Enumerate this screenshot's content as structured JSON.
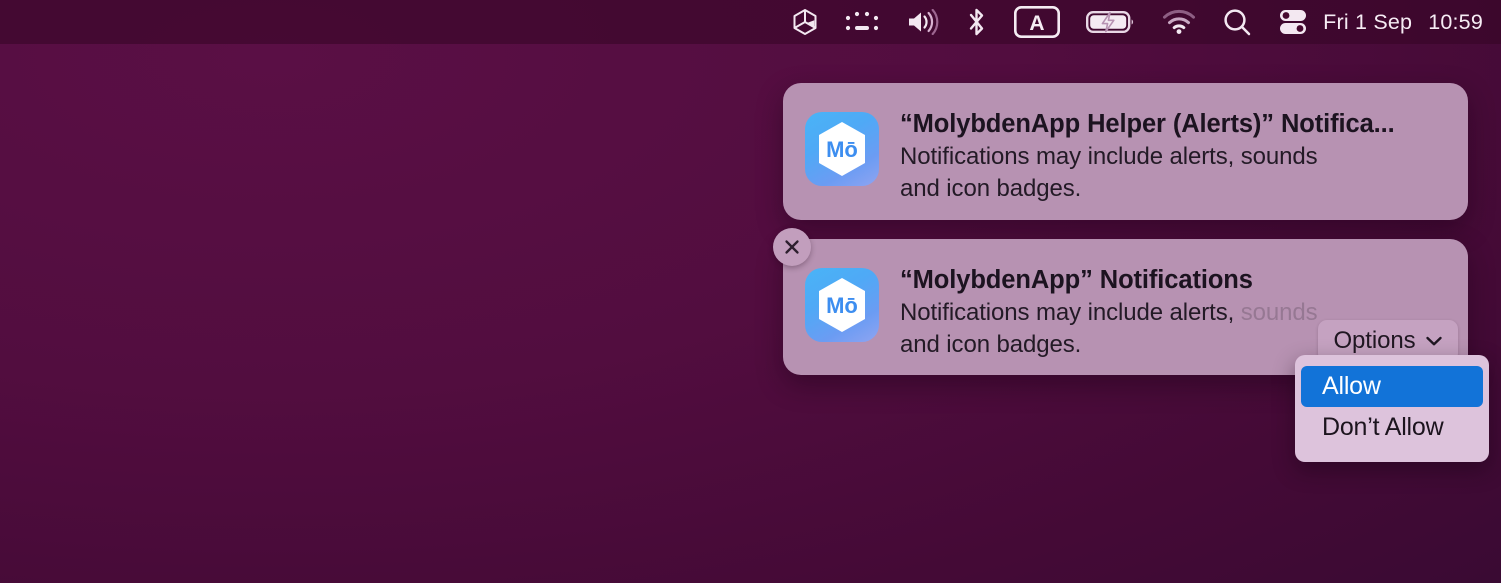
{
  "menubar": {
    "icons": [
      {
        "name": "cube-icon",
        "label": "Cube"
      },
      {
        "name": "keyboard-brightness-icon",
        "label": "Keyboard Brightness"
      },
      {
        "name": "volume-icon",
        "label": "Volume"
      },
      {
        "name": "bluetooth-icon",
        "label": "Bluetooth"
      },
      {
        "name": "input-source-icon",
        "label": "A"
      },
      {
        "name": "battery-charging-icon",
        "label": "Battery Charging"
      },
      {
        "name": "wifi-icon",
        "label": "Wi-Fi"
      },
      {
        "name": "search-icon",
        "label": "Spotlight Search"
      },
      {
        "name": "control-center-icon",
        "label": "Control Center"
      }
    ],
    "input_source_letter": "A",
    "date": "Fri 1 Sep",
    "time": "10:59"
  },
  "dialogs": [
    {
      "id": "helper",
      "app_icon_label": "Mō",
      "title": "“MolybdenApp Helper (Alerts)” Notifica...",
      "body": "Notifications may include alerts, sounds\nand icon badges."
    },
    {
      "id": "main",
      "app_icon_label": "Mō",
      "title": "“MolybdenApp” Notifications",
      "body_visible": "Notifications may include alerts, ",
      "body_faded": "sounds",
      "body_line2": "and icon badges."
    }
  ],
  "close_button": {
    "label": "×",
    "icon": "close-icon"
  },
  "options_button": {
    "label": "Options",
    "chevron_icon": "chevron-down-icon"
  },
  "options_dropdown": {
    "items": [
      {
        "label": "Allow",
        "selected": true
      },
      {
        "label": "Don’t Allow",
        "selected": false
      }
    ]
  },
  "colors": {
    "desktop": "#520d3f",
    "menubar": "#3b0827",
    "dialog_bg": "#b792b2",
    "dropdown_bg": "#ddc3dc",
    "highlight_blue": "#1273d8",
    "icon_blue_light": "#49b4f7",
    "icon_blue_dark": "#8fa4f2"
  }
}
